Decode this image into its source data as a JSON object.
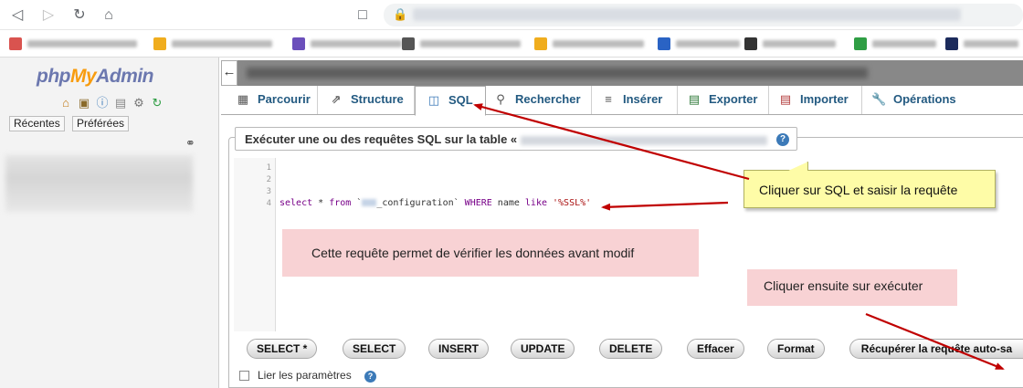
{
  "app": {
    "logo_php": "php",
    "logo_my": "My",
    "logo_admin": "Admin"
  },
  "sidebar": {
    "tabs": [
      "Récentes",
      "Préférées"
    ]
  },
  "tabs": [
    {
      "label": "Parcourir",
      "icon": "table-icon"
    },
    {
      "label": "Structure",
      "icon": "structure-icon"
    },
    {
      "label": "SQL",
      "icon": "sql-icon"
    },
    {
      "label": "Rechercher",
      "icon": "search-icon"
    },
    {
      "label": "Insérer",
      "icon": "insert-icon"
    },
    {
      "label": "Exporter",
      "icon": "export-icon"
    },
    {
      "label": "Importer",
      "icon": "import-icon"
    },
    {
      "label": "Opérations",
      "icon": "wrench-icon"
    }
  ],
  "active_tab": "SQL",
  "query_panel": {
    "legend": "Exécuter une ou des requêtes SQL sur la table «",
    "line_numbers": [
      "1",
      "2",
      "3",
      "4"
    ],
    "code": {
      "select": "select",
      "star": " * ",
      "from": "from",
      "table_open": " `",
      "table_suffix": "_configuration",
      "table_close": "` ",
      "where": "WHERE",
      "name": " name ",
      "like": "like",
      "value": " '%SSL%'"
    },
    "buttons": [
      "SELECT *",
      "SELECT",
      "INSERT",
      "UPDATE",
      "DELETE",
      "Effacer",
      "Format",
      "Récupérer la requête auto-sa"
    ],
    "checkbox_label": "Lier les paramètres"
  },
  "annotations": {
    "yellow_note": "Cliquer sur SQL et saisir la requête",
    "pink_note_1": "Cette requête permet de vérifier les données avant modif",
    "pink_note_2": "Cliquer ensuite sur exécuter"
  },
  "colors": {
    "tab_text": "#235a81",
    "arrow": "#c00000",
    "note_yellow": "#fefca7",
    "note_pink": "#f8d2d4"
  }
}
